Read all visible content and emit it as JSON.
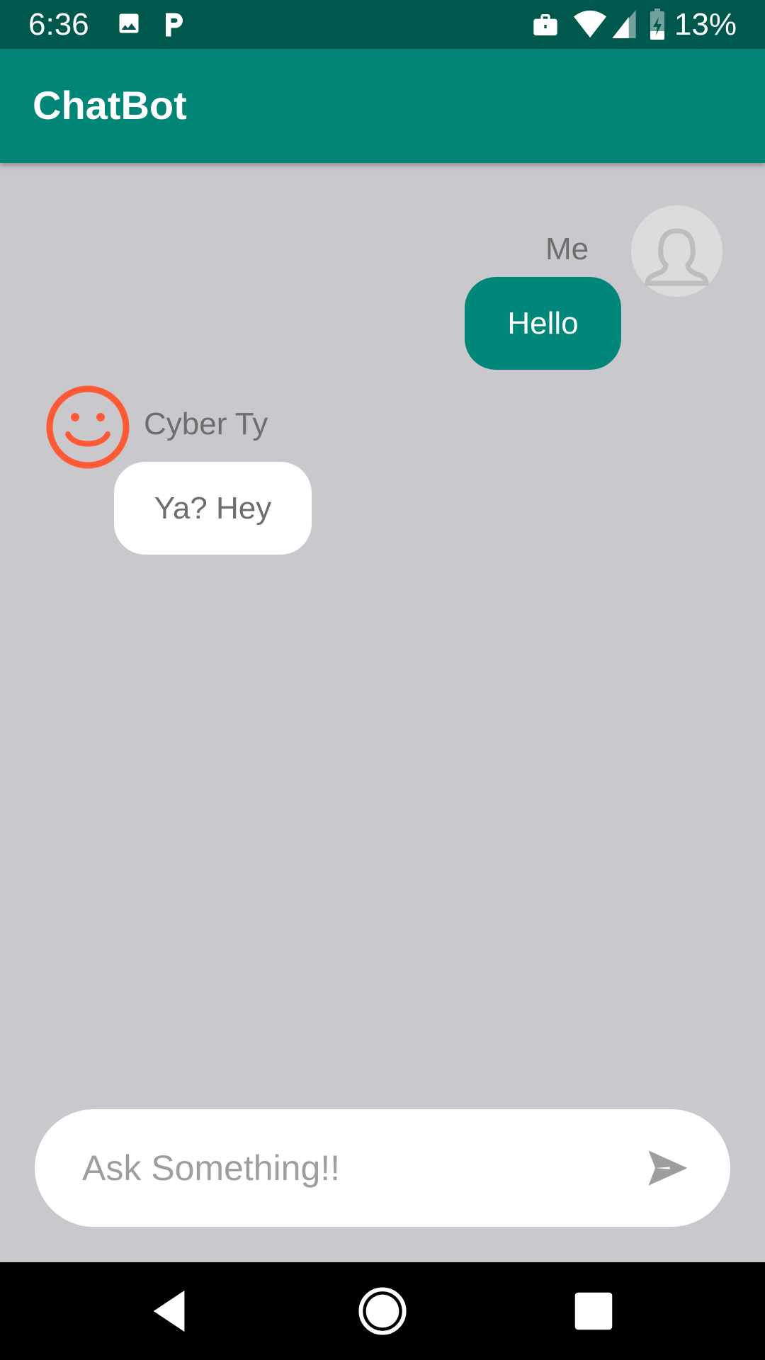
{
  "status_bar": {
    "time": "6:36",
    "battery_percent": "13%",
    "icons": [
      "image-icon",
      "parking-icon",
      "briefcase-icon",
      "wifi-icon",
      "signal-icon",
      "battery-charging-icon"
    ]
  },
  "app_bar": {
    "title": "ChatBot"
  },
  "chat": {
    "messages": [
      {
        "sender": "Me",
        "text": "Hello",
        "avatar_icon": "user-silhouette-icon",
        "side": "right"
      },
      {
        "sender": "Cyber Ty",
        "text": "Ya? Hey",
        "avatar_icon": "smiley-face-icon",
        "side": "left"
      }
    ]
  },
  "input": {
    "value": "",
    "placeholder": "Ask Something!!",
    "send_icon": "send-icon"
  },
  "nav_bar": {
    "icons": [
      "back-icon",
      "home-icon",
      "recents-icon"
    ]
  },
  "colors": {
    "status_bar": "#00574b",
    "app_bar": "#008577",
    "chat_background": "#c9c8cd",
    "my_bubble": "#00877a",
    "bot_bubble": "#ffffff",
    "bot_avatar": "#ff5a36"
  }
}
